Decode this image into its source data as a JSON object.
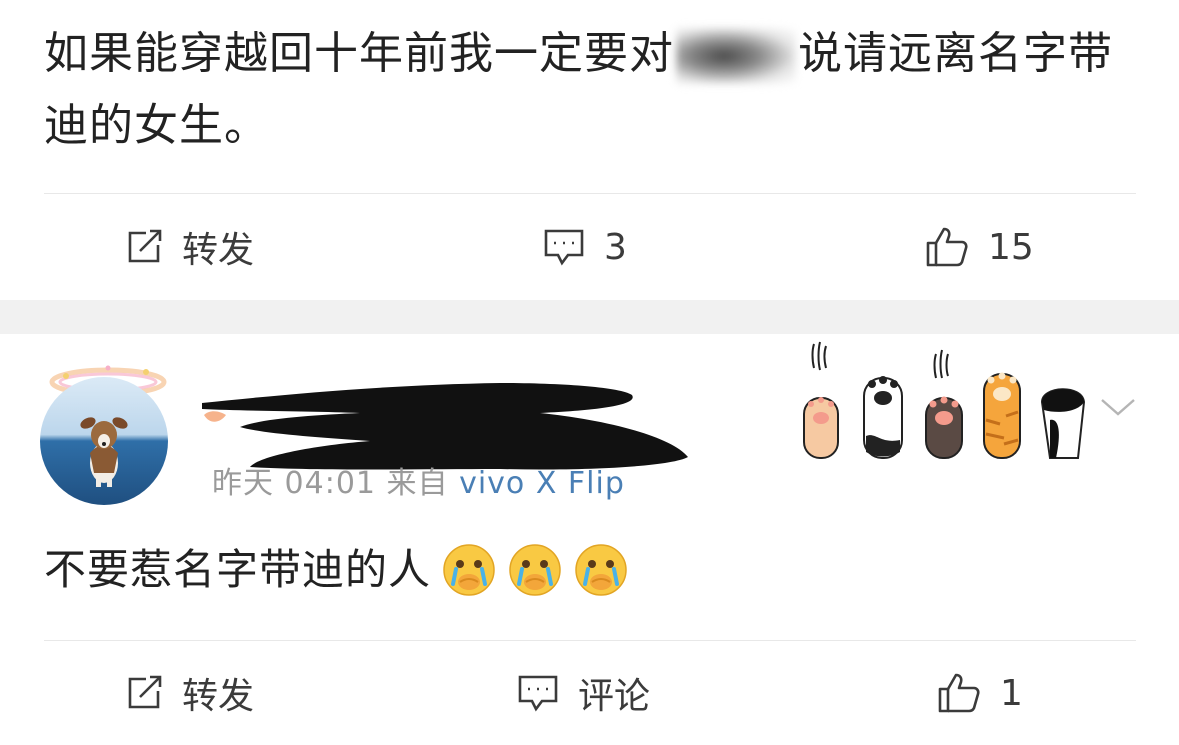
{
  "post": {
    "text_before": "如果能穿越回十年前我一定要对",
    "text_after": "说请远离名字带迪的女生。",
    "actions": {
      "repost_label": "转发",
      "comment_count": "3",
      "like_count": "15"
    }
  },
  "comment": {
    "time": "昨天 04:01",
    "source_prefix": "来自",
    "source": "vivo X Flip",
    "text": "不要惹名字带迪的人",
    "emoji": [
      "crying-face",
      "crying-face",
      "crying-face"
    ],
    "actions": {
      "repost_label": "转发",
      "comment_label": "评论",
      "like_count": "1"
    }
  },
  "colors": {
    "text": "#222222",
    "muted": "#9a9a9a",
    "source": "#4a7fb5",
    "divider": "#e8e8e8",
    "band": "#f1f1f1"
  },
  "icons": [
    "share-icon",
    "comment-icon",
    "like-icon",
    "chevron-down-icon",
    "cat-paws-decoration"
  ]
}
